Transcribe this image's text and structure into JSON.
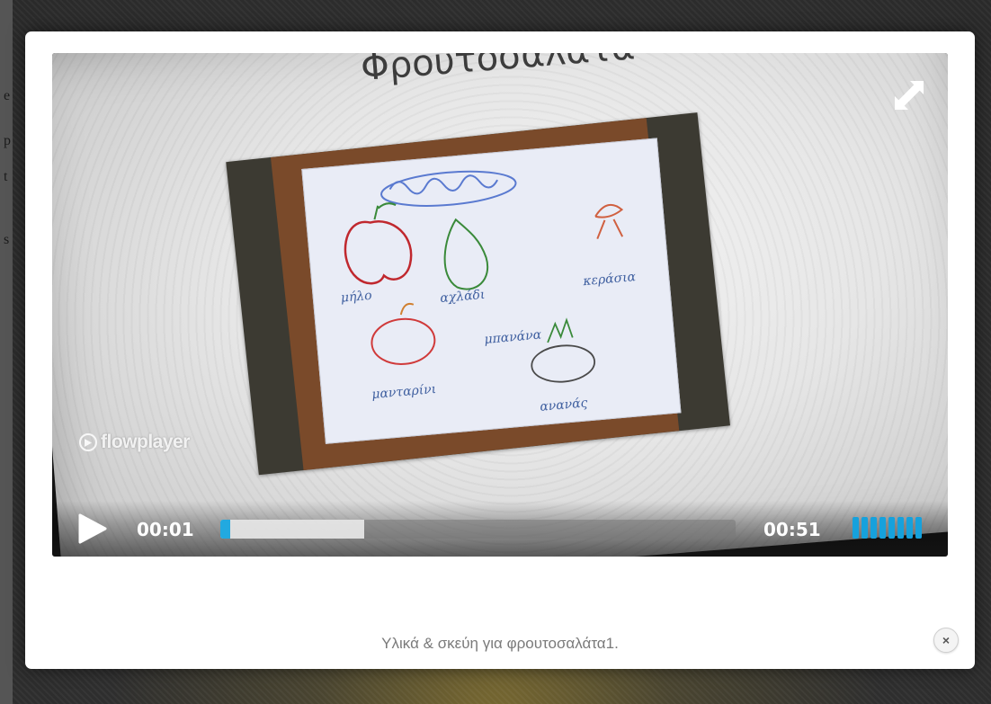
{
  "video": {
    "title": "Φρουτοσαλάτα",
    "watermark": "flowplayer",
    "elapsed": "00:01",
    "duration": "00:51",
    "progress_fraction": 0.02,
    "buffered_fraction": 0.28,
    "volume_level_bars": 8,
    "volume_total_bars": 8
  },
  "controls": {
    "play_icon": "play-icon",
    "fullscreen_icon": "fullscreen-icon",
    "accent_color": "#22a9e0"
  },
  "caption": {
    "text": "Υλικά & σκεύη για φρουτοσαλάτα1."
  },
  "close": {
    "icon": "close-icon",
    "glyph": "×"
  },
  "background_edge_glyphs": [
    "e",
    "p",
    "t",
    "s"
  ]
}
